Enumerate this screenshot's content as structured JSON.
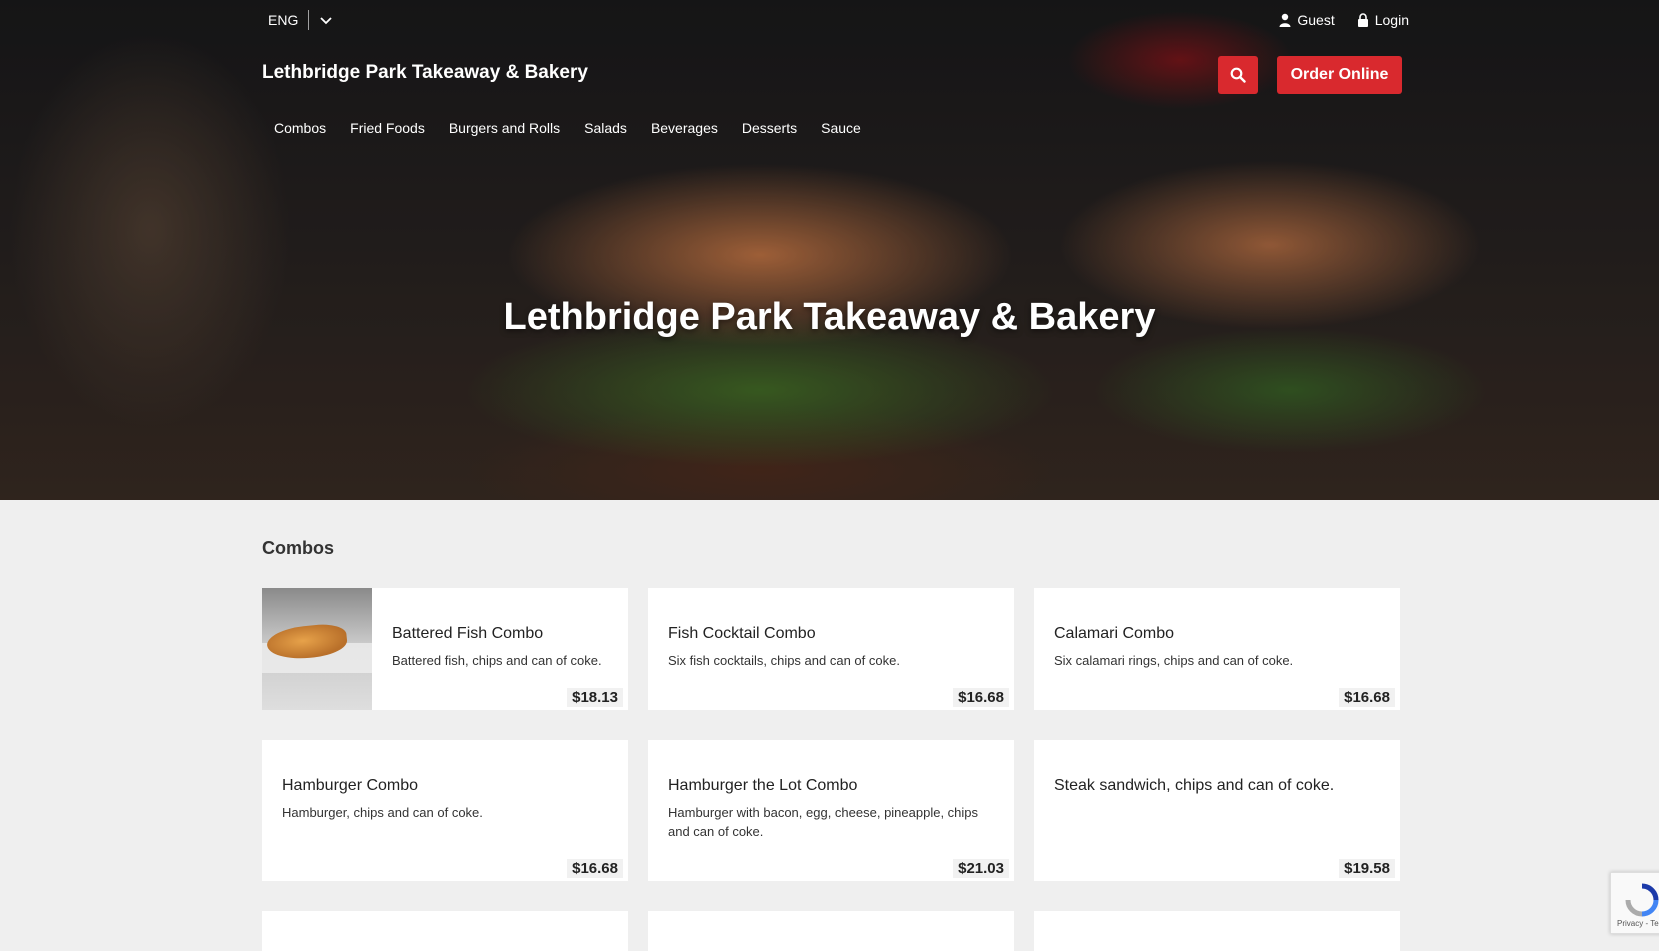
{
  "header": {
    "language": "ENG",
    "guest_label": "Guest",
    "login_label": "Login",
    "brand": "Lethbridge Park Takeaway & Bakery",
    "order_button": "Order Online",
    "nav": [
      "Combos",
      "Fried Foods",
      "Burgers and Rolls",
      "Salads",
      "Beverages",
      "Desserts",
      "Sauce"
    ]
  },
  "hero": {
    "title": "Lethbridge Park Takeaway & Bakery"
  },
  "menu": {
    "section_title": "Combos",
    "items": [
      {
        "name": "Battered Fish Combo",
        "desc": "Battered fish, chips and can of coke.",
        "price": "$18.13"
      },
      {
        "name": "Fish Cocktail Combo",
        "desc": "Six fish cocktails, chips and can of coke.",
        "price": "$16.68"
      },
      {
        "name": "Calamari Combo",
        "desc": "Six calamari rings, chips and can of coke.",
        "price": "$16.68"
      },
      {
        "name": "Hamburger Combo",
        "desc": "Hamburger, chips and can of coke.",
        "price": "$16.68"
      },
      {
        "name": "Hamburger the Lot Combo",
        "desc": "Hamburger with bacon, egg, cheese, pineapple, chips and can of coke.",
        "price": "$21.03"
      },
      {
        "name": "Steak sandwich, chips and can of coke.",
        "desc": "",
        "price": "$19.58"
      }
    ]
  },
  "recaptcha": {
    "text": "Privacy - Te"
  },
  "colors": {
    "accent": "#d9292e",
    "background": "#efefef",
    "card": "#ffffff"
  }
}
